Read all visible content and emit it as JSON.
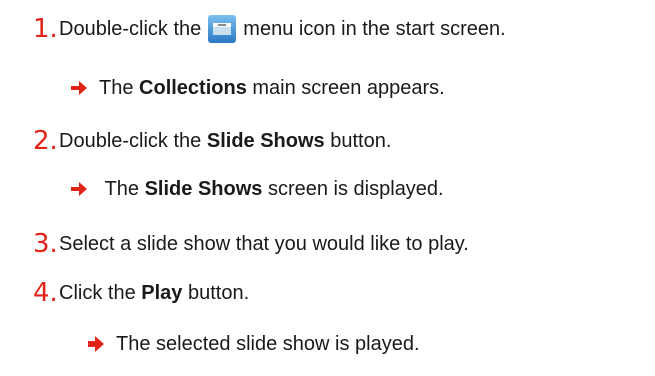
{
  "steps": [
    {
      "number": "1.",
      "before": "Double-click the",
      "icon": "collections-menu-icon",
      "after": "menu icon in the start screen.",
      "result_before": "The",
      "result_bold": "Collections",
      "result_after": "main screen appears."
    },
    {
      "number": "2.",
      "before": "Double-click the",
      "bold": "Slide Shows",
      "after": "button.",
      "result_before": "The",
      "result_bold": "Slide Shows",
      "result_after": "screen is displayed."
    },
    {
      "number": "3.",
      "text": "Select a slide show that you would like to play."
    },
    {
      "number": "4.",
      "before": "Click the",
      "bold": "Play",
      "after": "button.",
      "result_text": "The selected slide show is played."
    }
  ],
  "colors": {
    "accent": "#e2231a",
    "text": "#1a1a1a",
    "icon_blue": "#3a8fd6"
  }
}
